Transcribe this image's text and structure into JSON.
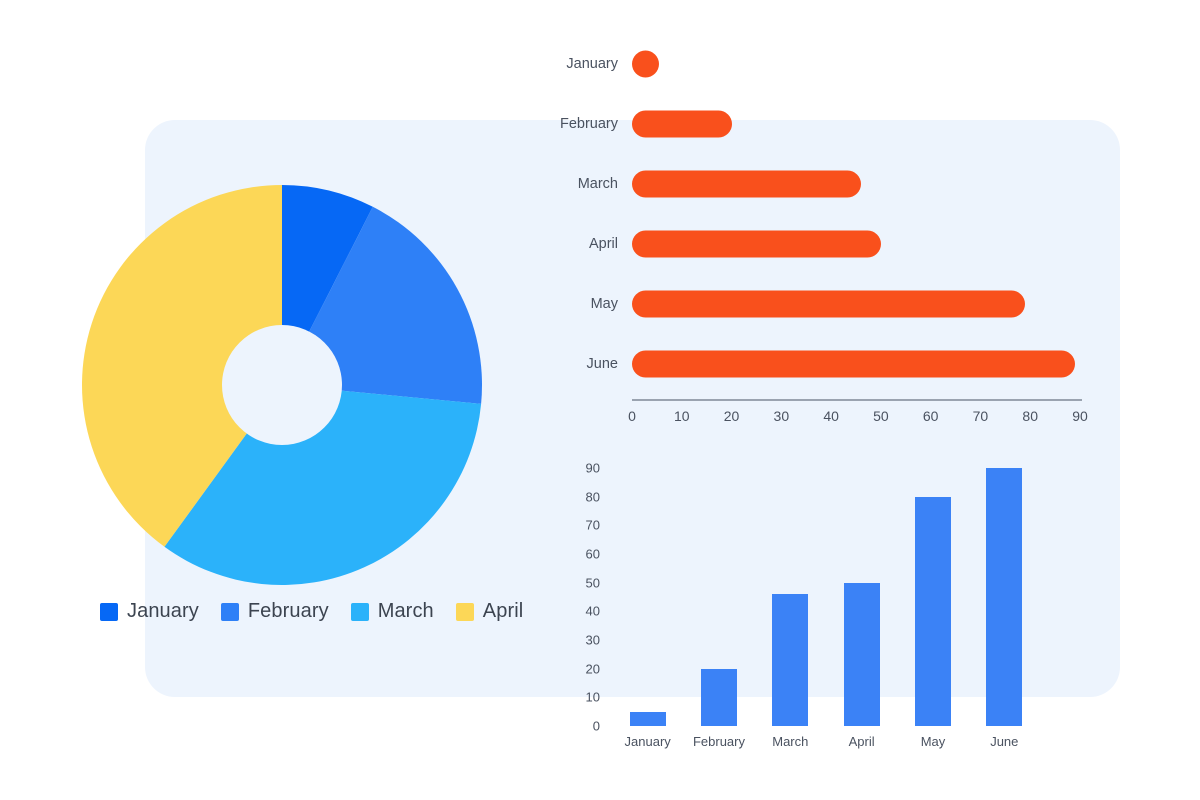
{
  "palette": {
    "card_background": "#EDF4FD",
    "page_background": "#FFFFFF",
    "donut_hole": "#EDF4FD",
    "orange": "#F9501C",
    "blue_bar": "#3B82F6",
    "january": "#0668F5",
    "february": "#2E80F7",
    "march": "#2BB2FA",
    "april": "#FCD757",
    "axis_line": "#9AA3B0",
    "label_text": "#4A5260"
  },
  "donut": {
    "legend": [
      {
        "label": "January",
        "color": "#0668F5"
      },
      {
        "label": "February",
        "color": "#2E80F7"
      },
      {
        "label": "March",
        "color": "#2BB2FA"
      },
      {
        "label": "April",
        "color": "#FCD757"
      }
    ]
  },
  "chart_data": [
    {
      "type": "pie",
      "title": "",
      "variant": "donut",
      "legend_position": "bottom-left",
      "labels": [
        "January",
        "February",
        "March",
        "April"
      ],
      "values": [
        7.5,
        19,
        33.5,
        40
      ],
      "unit": "percent",
      "colors": [
        "#0668F5",
        "#2E80F7",
        "#2BB2FA",
        "#FCD757"
      ],
      "start_angle": 0,
      "inner_radius_ratio": 0.3
    },
    {
      "type": "bar",
      "orientation": "horizontal",
      "title": "",
      "xlabel": "",
      "ylabel": "",
      "categories": [
        "January",
        "February",
        "March",
        "April",
        "May",
        "June"
      ],
      "values": [
        5,
        20,
        46,
        50,
        79,
        89
      ],
      "xlim": [
        0,
        90
      ],
      "xticks": [
        "0",
        "10",
        "20",
        "30",
        "40",
        "50",
        "60",
        "70",
        "80",
        "90"
      ],
      "grid": false,
      "bar_color": "#F9501C",
      "rounded_caps": true
    },
    {
      "type": "bar",
      "orientation": "vertical",
      "title": "",
      "xlabel": "",
      "ylabel": "",
      "categories": [
        "January",
        "February",
        "March",
        "April",
        "May",
        "June"
      ],
      "values": [
        5,
        20,
        46,
        50,
        80,
        90
      ],
      "ylim": [
        0,
        90
      ],
      "yticks": [
        "0",
        "10",
        "20",
        "30",
        "40",
        "50",
        "60",
        "70",
        "80",
        "90"
      ],
      "grid": false,
      "bar_color": "#3B82F6"
    }
  ]
}
